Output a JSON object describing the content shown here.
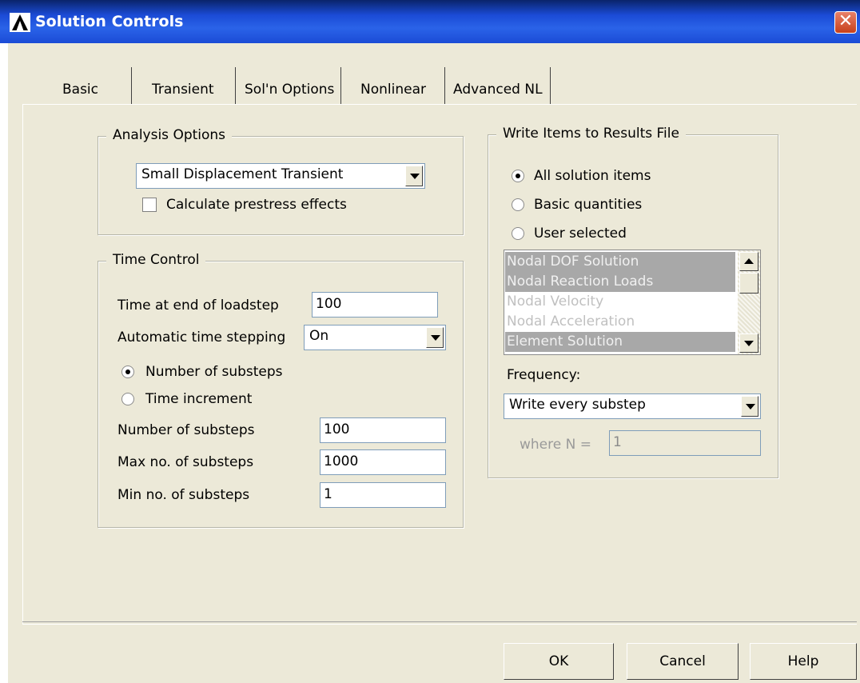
{
  "window": {
    "title": "Solution Controls"
  },
  "tabs": [
    {
      "label": "Basic"
    },
    {
      "label": "Transient"
    },
    {
      "label": "Sol'n Options"
    },
    {
      "label": "Nonlinear"
    },
    {
      "label": "Advanced NL"
    }
  ],
  "analysis": {
    "title": "Analysis Options",
    "type": "Small Displacement Transient",
    "prestress_label": "Calculate prestress effects",
    "prestress_checked": false
  },
  "time": {
    "title": "Time Control",
    "end_label": "Time at end of loadstep",
    "end_value": "100",
    "auto_label": "Automatic time stepping",
    "auto_value": "On",
    "radio_substeps": "Number of substeps",
    "radio_increment": "Time increment",
    "selected": "Number of substeps",
    "num_label": "Number of substeps",
    "num_value": "100",
    "max_label": "Max no. of substeps",
    "max_value": "1000",
    "min_label": "Min no. of substeps",
    "min_value": "1"
  },
  "results": {
    "title": "Write Items to Results File",
    "radio_all": "All solution items",
    "radio_basic": "Basic quantities",
    "radio_user": "User selected",
    "selected": "All solution items",
    "items": [
      {
        "label": "Nodal DOF Solution",
        "selected": true
      },
      {
        "label": "Nodal Reaction Loads",
        "selected": true
      },
      {
        "label": "Nodal Velocity",
        "selected": false
      },
      {
        "label": "Nodal Acceleration",
        "selected": false
      },
      {
        "label": "Element Solution",
        "selected": true
      }
    ],
    "frequency_label": "Frequency:",
    "frequency_value": "Write every substep",
    "where_label": "where N =",
    "where_value": "1"
  },
  "buttons": {
    "ok": "OK",
    "cancel": "Cancel",
    "help": "Help"
  }
}
